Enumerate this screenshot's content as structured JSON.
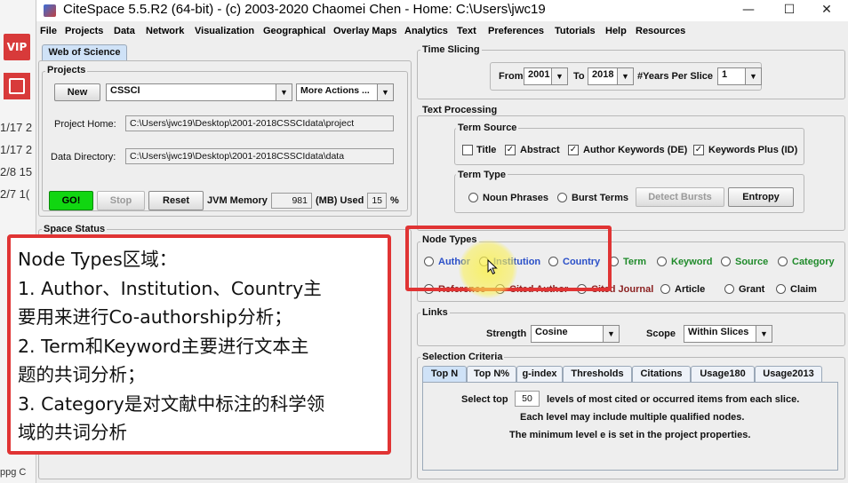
{
  "background_app": {
    "vip_label": "VIP",
    "dates": [
      "1/17 2",
      "1/17 2",
      "2/8 15",
      "2/7 1("
    ],
    "bottom_text": "ppg C"
  },
  "window": {
    "title": "CiteSpace 5.5.R2 (64-bit) - (c) 2003-2020 Chaomei Chen - Home: C:\\Users\\jwc19",
    "controls": {
      "minimize": "—",
      "maximize": "☐",
      "close": "✕"
    }
  },
  "menu": [
    "File",
    "Projects",
    "Data",
    "Network",
    "Visualization",
    "Geographical",
    "Overlay Maps",
    "Analytics",
    "Text",
    "Preferences",
    "Tutorials",
    "Help",
    "Resources"
  ],
  "left": {
    "tab_label": "Web of Science",
    "projects_label": "Projects",
    "new_button": "New",
    "project_select": "CSSCI",
    "more_actions": "More Actions ...",
    "project_home_label": "Project Home:",
    "project_home_value": "C:\\Users\\jwc19\\Desktop\\2001-2018CSSCIdata\\project",
    "data_dir_label": "Data Directory:",
    "data_dir_value": "C:\\Users\\jwc19\\Desktop\\2001-2018CSSCIdata\\data",
    "go_button": "GO!",
    "stop_button": "Stop",
    "reset_button": "Reset",
    "jvm_label": "JVM Memory",
    "jvm_value": "981",
    "mb_used_label": "(MB) Used",
    "used_value": "15",
    "percent": "%",
    "space_status_label": "Space Status"
  },
  "time_slicing": {
    "label": "Time Slicing",
    "from_label": "From",
    "from_value": "2001",
    "to_label": "To",
    "to_value": "2018",
    "years_label": "#Years Per Slice",
    "years_value": "1"
  },
  "text_processing": {
    "label": "Text Processing",
    "term_source_label": "Term Source",
    "sources": [
      {
        "label": "Title",
        "checked": false
      },
      {
        "label": "Abstract",
        "checked": true
      },
      {
        "label": "Author Keywords (DE)",
        "checked": true
      },
      {
        "label": "Keywords Plus (ID)",
        "checked": true
      }
    ],
    "term_type_label": "Term Type",
    "noun_phrases": "Noun Phrases",
    "burst_terms": "Burst Terms",
    "detect_bursts": "Detect Bursts",
    "entropy": "Entropy"
  },
  "node_types": {
    "label": "Node Types",
    "row1": [
      {
        "label": "Author",
        "color": "#2a4fc8"
      },
      {
        "label": "Institution",
        "color": "#2a4fc8"
      },
      {
        "label": "Country",
        "color": "#2a4fc8"
      },
      {
        "label": "Term",
        "color": "#1f8a2a"
      },
      {
        "label": "Keyword",
        "color": "#1f8a2a"
      },
      {
        "label": "Source",
        "color": "#1f8a2a"
      },
      {
        "label": "Category",
        "color": "#1f8a2a"
      }
    ],
    "row2": [
      {
        "label": "Reference",
        "color": "#8a1f1f"
      },
      {
        "label": "Cited Author",
        "color": "#8a1f1f"
      },
      {
        "label": "Cited Journal",
        "color": "#8a1f1f"
      },
      {
        "label": "Article",
        "color": "#222222"
      },
      {
        "label": "Grant",
        "color": "#222222"
      },
      {
        "label": "Claim",
        "color": "#222222"
      }
    ]
  },
  "links": {
    "label": "Links",
    "strength_label": "Strength",
    "strength_value": "Cosine",
    "scope_label": "Scope",
    "scope_value": "Within Slices"
  },
  "selection": {
    "label": "Selection Criteria",
    "tabs": [
      "Top N",
      "Top N%",
      "g-index",
      "Thresholds",
      "Citations",
      "Usage180",
      "Usage2013"
    ],
    "select_top_label": "Select top",
    "select_top_value": "50",
    "levels_text": "levels of most cited or occurred items from each slice.",
    "line2": "Each level may include multiple qualified nodes.",
    "line3": "The minimum level e is set in the project properties."
  },
  "annotation": {
    "lines": [
      "Node Types区域：",
      "1. Author、Institution、Country主",
      "要用来进行Co-authorship分析；",
      "2. Term和Keyword主要进行文本主",
      "题的共词分析；",
      "3. Category是对文献中标注的科学领",
      "域的共词分析"
    ],
    "border_color": "#e03434"
  }
}
